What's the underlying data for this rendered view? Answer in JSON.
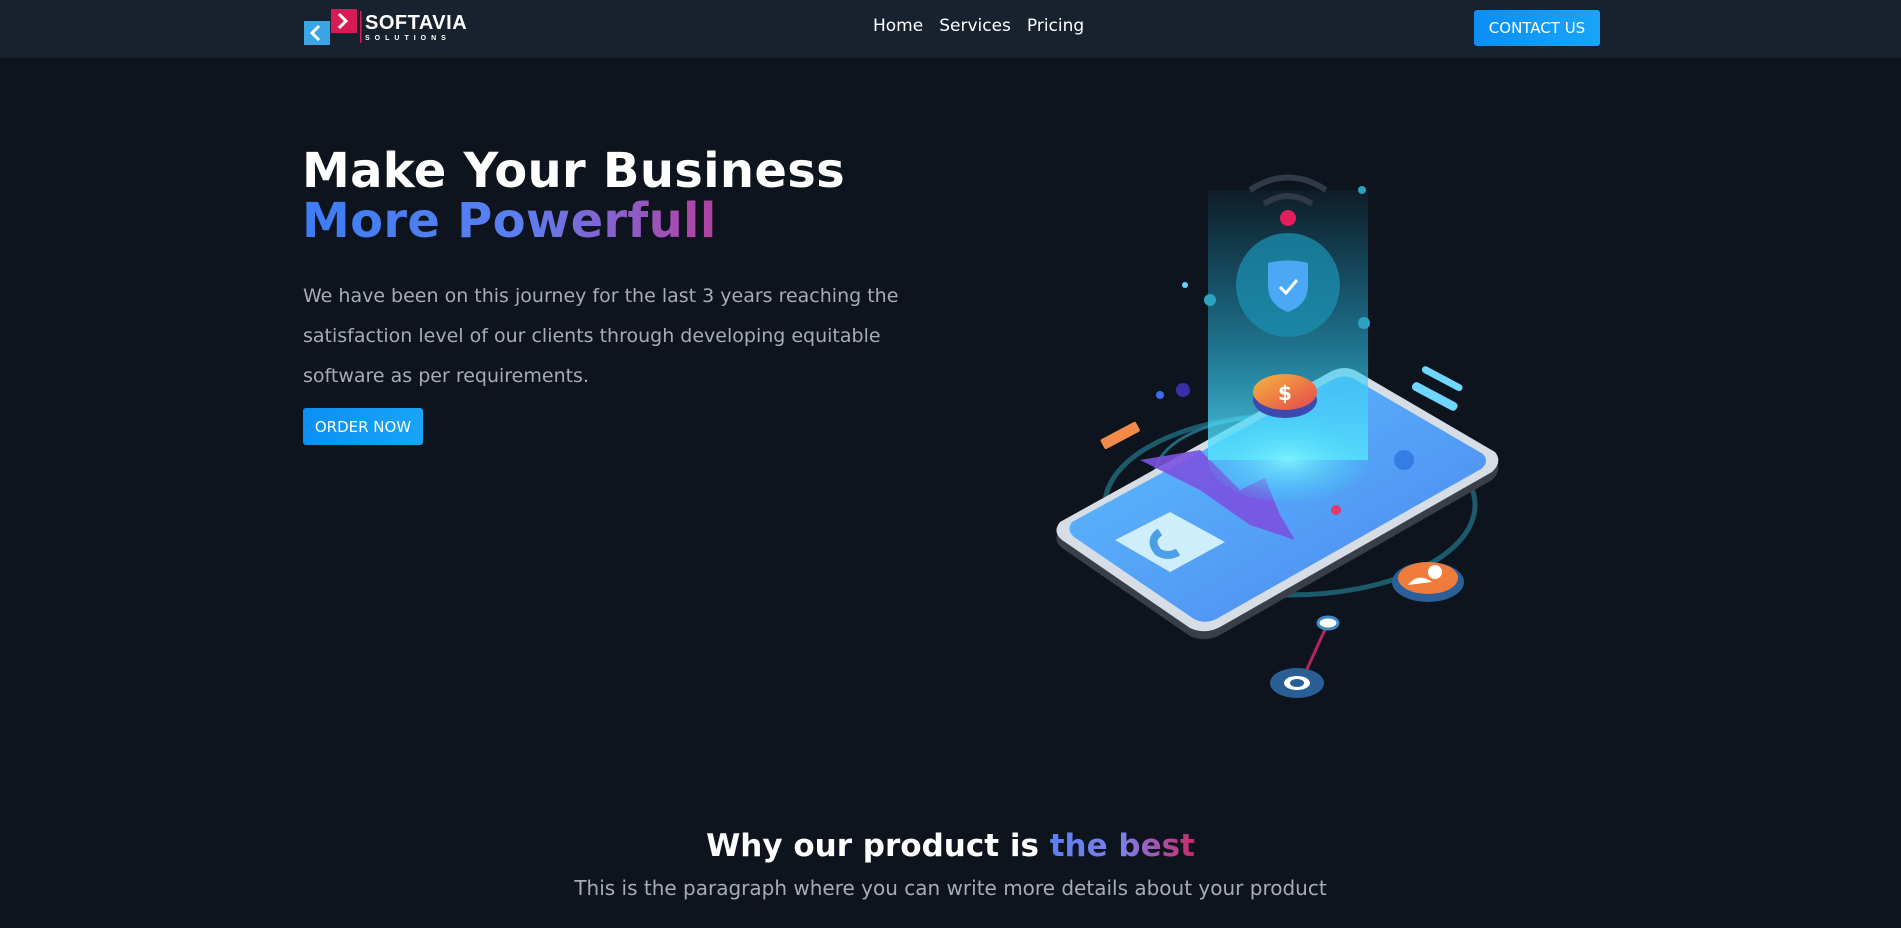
{
  "brand": {
    "name": "SOFTAVIA",
    "tagline": "SOLUTIONS",
    "colors": {
      "primary": "#0a8ff5",
      "background": "#0e141d",
      "navbar": "#18212e",
      "gradient_start": "#3d7df4",
      "gradient_end": "#d11a55",
      "muted_text": "#a5acb8"
    }
  },
  "nav": {
    "links": [
      {
        "label": "Home"
      },
      {
        "label": "Services"
      },
      {
        "label": "Pricing"
      }
    ],
    "contact_label": "CONTACT US"
  },
  "hero": {
    "title_line1": "Make Your Business",
    "title_line2": "More Powerfull",
    "description": "We have been on this journey for the last 3 years reaching the satisfaction level of our clients through developing equitable software as per requirements.",
    "cta_label": "ORDER NOW",
    "illustration_icons": [
      "smartphone-icon",
      "shield-check-icon",
      "dollar-coin-icon",
      "wifi-icon",
      "user-avatar-icon",
      "chat-icon",
      "location-pin-icon"
    ]
  },
  "features": {
    "title_prefix": "Why our product is",
    "title_accent": "the best",
    "subtitle": "This is the paragraph where you can write more details about your product"
  }
}
